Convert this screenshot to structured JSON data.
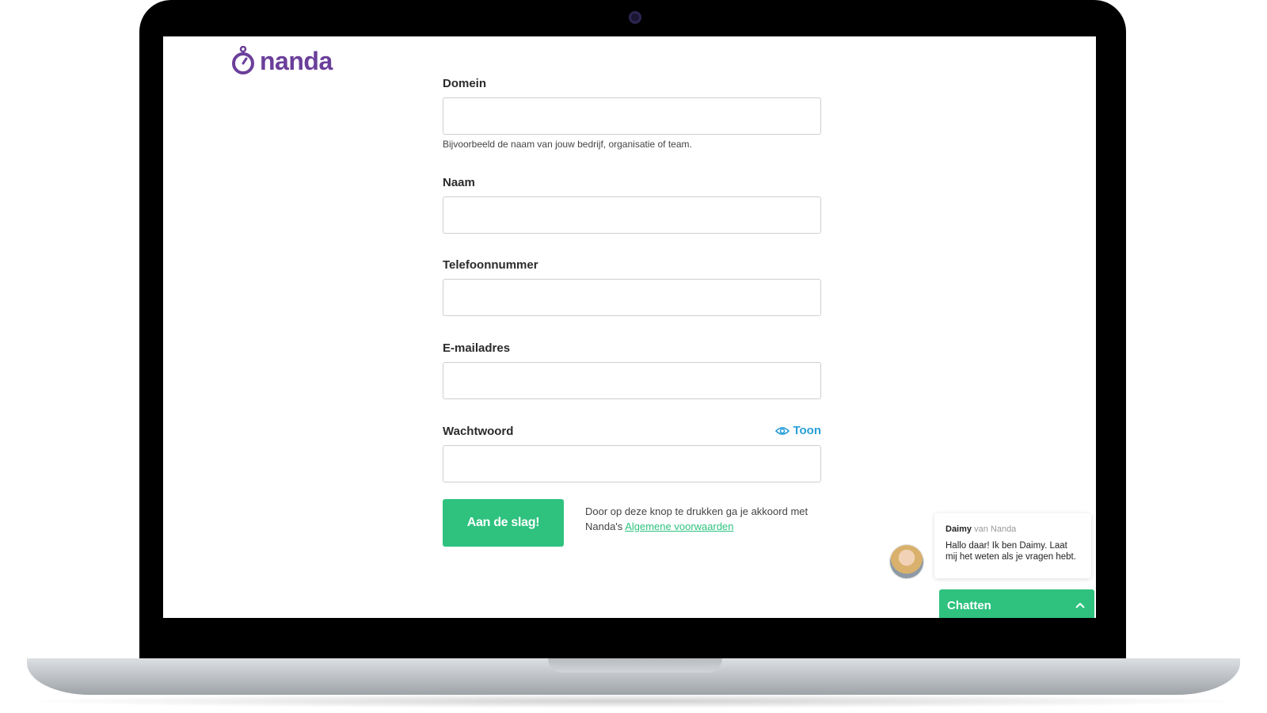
{
  "brand": {
    "name": "nanda",
    "color": "#6b3f9a"
  },
  "form": {
    "domain": {
      "label": "Domein",
      "value": "",
      "hint": "Bijvoorbeeld de naam van jouw bedrijf, organisatie of team."
    },
    "name": {
      "label": "Naam",
      "value": ""
    },
    "phone": {
      "label": "Telefoonnummer",
      "value": ""
    },
    "email": {
      "label": "E-mailadres",
      "value": ""
    },
    "password": {
      "label": "Wachtwoord",
      "value": "",
      "show_label": "Toon"
    },
    "submit_label": "Aan de slag!",
    "terms_text": "Door op deze knop te drukken ga je akkoord met Nanda's",
    "terms_link": "Algemene voorwaarden"
  },
  "chat": {
    "agent_name": "Daimy",
    "agent_org": "van Nanda",
    "message": "Hallo daar! Ik ben Daimy. Laat mij het weten als je vragen hebt.",
    "bar_label": "Chatten"
  },
  "colors": {
    "accent_green": "#2ec27e",
    "link_blue": "#2a9fd8",
    "laptop_bezel": "#000000"
  },
  "icons": [
    "stopwatch-logo-icon",
    "eye-icon",
    "chevron-up-icon"
  ]
}
